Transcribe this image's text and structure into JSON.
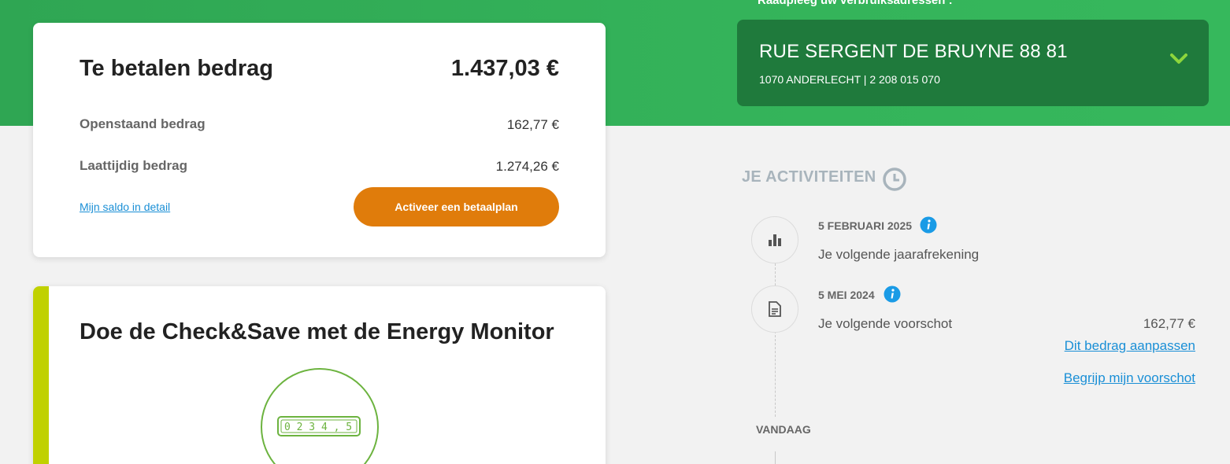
{
  "address_section": {
    "heading": "Raadpleeg uw verbruiksadressen :",
    "street": "RUE SERGENT DE BRUYNE 88 81",
    "city_line": "1070 ANDERLECHT  |  2 208 015 070",
    "chevron_icon": "chevron-down-icon",
    "chevron_color": "#8dd63c"
  },
  "payment": {
    "title": "Te betalen bedrag",
    "total": "1.437,03 €",
    "rows": [
      {
        "label": "Openstaand bedrag",
        "value": "162,77 €"
      },
      {
        "label": "Laattijdig bedrag",
        "value": "1.274,26 €"
      }
    ],
    "detail_link": "Mijn saldo in detail",
    "plan_button": "Activeer een betaalplan",
    "button_color": "#e07c0b"
  },
  "check_save": {
    "title": "Doe de Check&Save met de Energy Monitor",
    "meter_digits": "0 2 3 4 , 5",
    "accent_color": "#c0d100"
  },
  "activities": {
    "heading": "JE ACTIVITEITEN",
    "heading_icon": "clock-icon",
    "items": [
      {
        "icon": "bar-chart-icon",
        "date": "5 FEBRUARI 2025",
        "text": "Je volgende jaarafrekening"
      },
      {
        "icon": "document-icon",
        "date": "5 MEI 2024",
        "text": "Je volgende voorschot",
        "amount": "162,77 €",
        "links": [
          "Dit bedrag aanpassen",
          "Begrijp mijn voorschot"
        ]
      }
    ],
    "today_label": "VANDAAG"
  },
  "colors": {
    "brand_green": "#34b35a",
    "dark_green": "#1f7a3c",
    "link_blue": "#1a8fd6",
    "info_blue": "#1a9be6"
  }
}
